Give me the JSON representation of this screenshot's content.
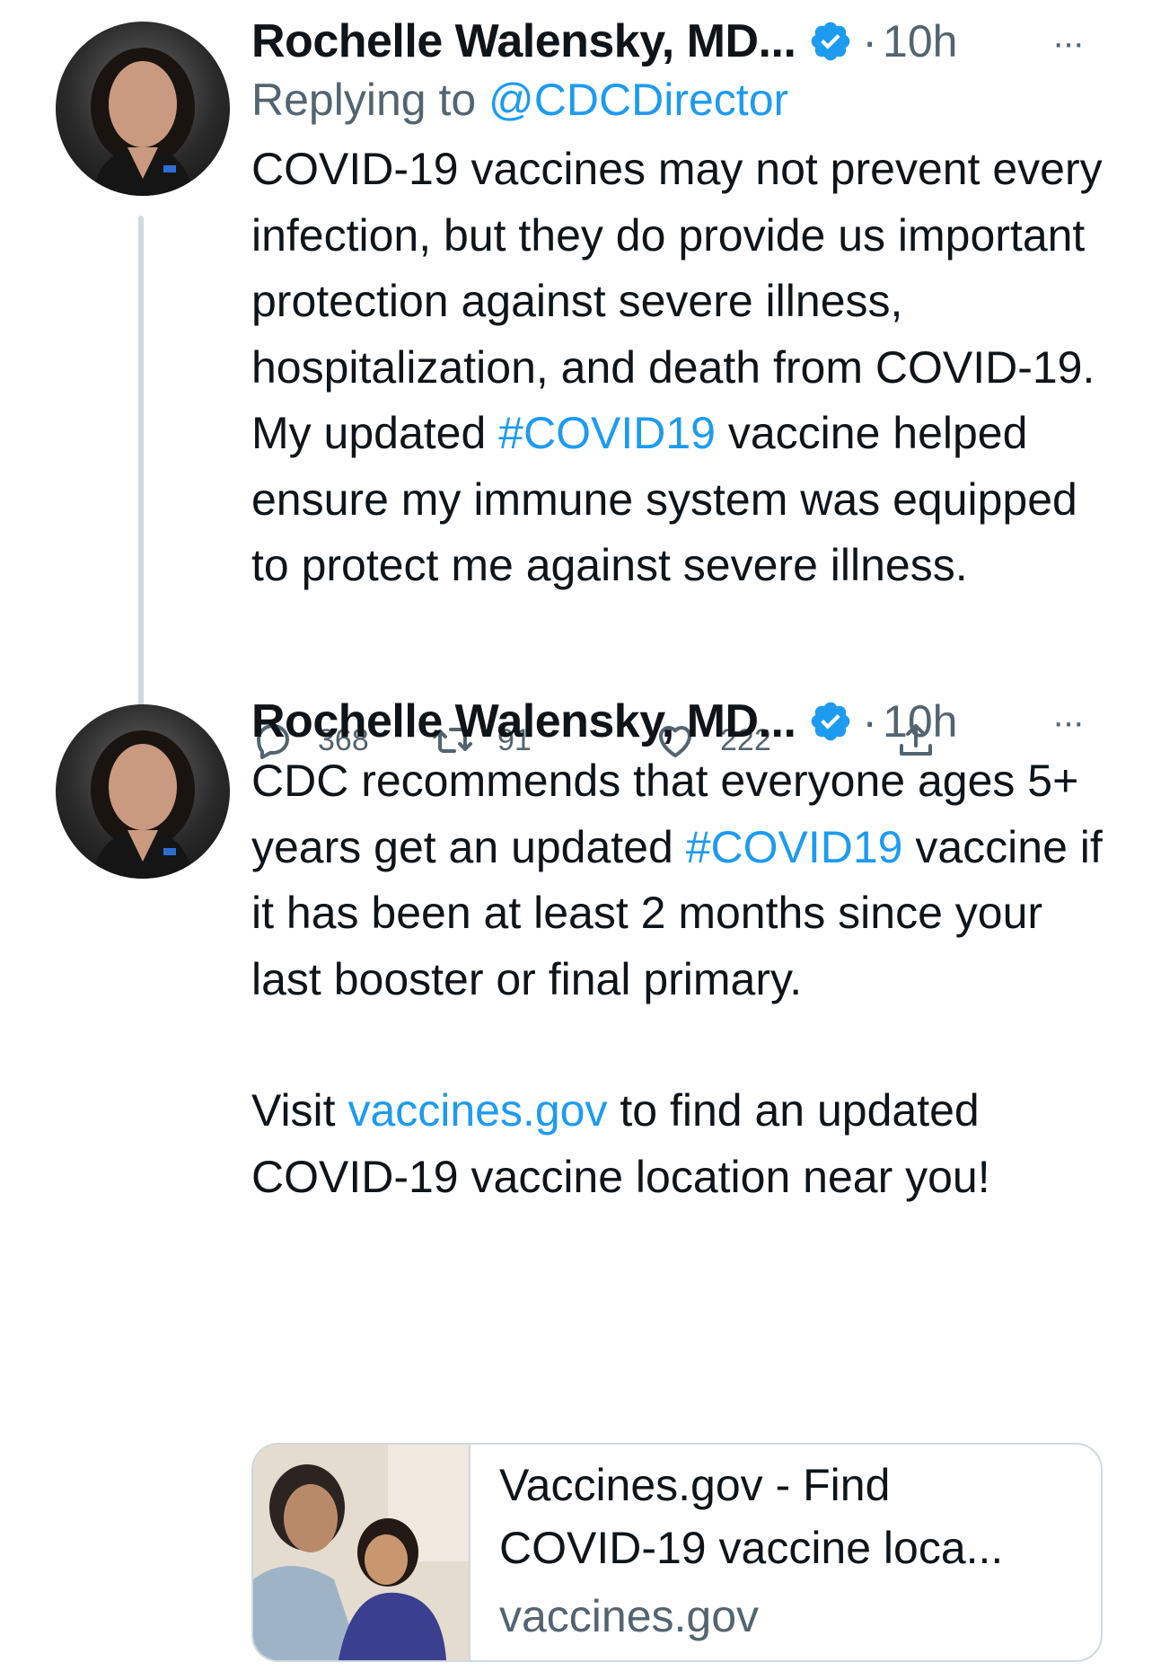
{
  "tweets": [
    {
      "author": "Rochelle Walensky, MD...",
      "time": "10h",
      "reply_prefix": "Replying to ",
      "reply_handle": "@CDCDirector",
      "text_1": "COVID-19 vaccines may not prevent every infection, but they do provide us important protection against severe illness, hospitalization, and death from COVID-19. My updated ",
      "hashtag": "#COVID19",
      "text_2": " vaccine helped ensure my immune system was equipped to protect me against severe illness.",
      "stats": {
        "replies": "368",
        "retweets": "91",
        "likes": "222"
      }
    },
    {
      "author": "Rochelle Walensky, MD...",
      "time": "10h",
      "text_1": "CDC recommends that everyone ages 5+ years get an updated ",
      "hashtag": "#COVID19",
      "text_2": " vaccine if it has been at least 2 months since your last booster or final primary.",
      "text_3": "Visit ",
      "link": "vaccines.gov",
      "text_4": " to find an updated COVID-19 vaccine location near you!",
      "card": {
        "title_line1": "Vaccines.gov - Find",
        "title_line2": "COVID-19 vaccine loca...",
        "domain": "vaccines.gov"
      }
    }
  ],
  "meta": {
    "dot": "·",
    "more": "···"
  },
  "colors": {
    "accent": "#1d9bf0",
    "muted": "#536471",
    "text": "#0f1419"
  },
  "icons": [
    "verified-badge-icon",
    "more-icon",
    "reply-icon",
    "retweet-icon",
    "like-icon",
    "share-icon"
  ]
}
